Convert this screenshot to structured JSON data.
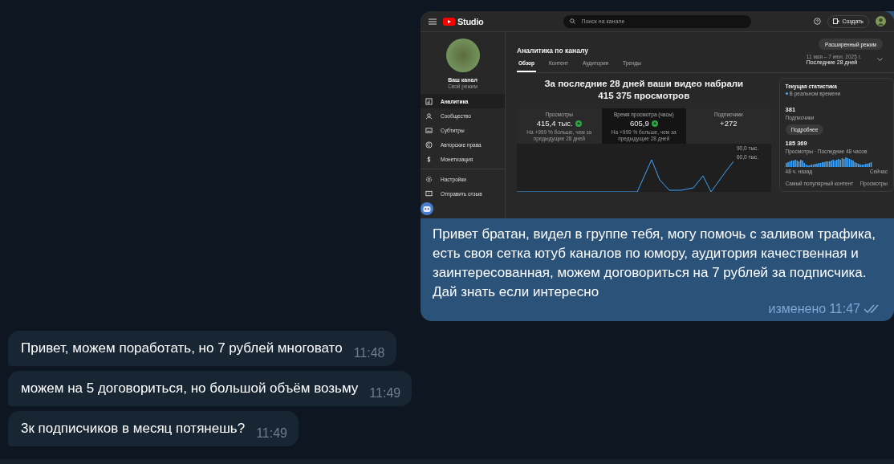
{
  "studio_screenshot": {
    "topbar": {
      "logo_text": "Studio",
      "search": {
        "placeholder": "Поиск на канале"
      },
      "create_button": "Создать"
    },
    "sidebar": {
      "channel_name": "Ваш канал",
      "channel_subtitle": "Свой режим",
      "items": [
        {
          "label": "Аналитика",
          "selected": true
        },
        {
          "label": "Сообщество",
          "selected": false
        },
        {
          "label": "Субтитры",
          "selected": false
        },
        {
          "label": "Авторские права",
          "selected": false
        },
        {
          "label": "Монетизация",
          "selected": false
        }
      ],
      "bottom_items": [
        {
          "label": "Настройки",
          "selected": false
        },
        {
          "label": "Отправить отзыв",
          "selected": false
        }
      ]
    },
    "page_title": "Аналитика по каналу",
    "advanced_button": "Расширенный режим",
    "date_range": {
      "dates": "11 мая – 7 июн. 2025 г.",
      "period": "Последние 28 дней"
    },
    "tabs": [
      {
        "label": "Обзор",
        "selected": true
      },
      {
        "label": "Контент",
        "selected": false
      },
      {
        "label": "Аудитория",
        "selected": false
      },
      {
        "label": "Тренды",
        "selected": false
      }
    ],
    "headline": "За последние 28 дней ваши видео набрали 415 375 просмотров",
    "metrics": [
      {
        "label": "Просмотры",
        "value": "415,4 тыс.",
        "rising": true,
        "note": "На +999 % больше, чем за предыдущие 28 дней",
        "selected": false
      },
      {
        "label": "Время просмотра (часы)",
        "value": "605,9",
        "rising": true,
        "note": "На +999 % больше, чем за предыдущие 28 дней",
        "selected": true
      },
      {
        "label": "Подписчики",
        "value": "+272",
        "rising": false,
        "selected": false
      }
    ],
    "chart_ticks": [
      "90,0 тыс.",
      "60,0 тыс."
    ],
    "realtime": {
      "title": "Текущая статистика",
      "live_label": "В реальном времени",
      "subscribers": "381",
      "subscribers_label": "Подписчики",
      "details_button": "Подробнее",
      "views": "185 369",
      "views_label": "Просмотры · Последние 48 часов",
      "from_label": "48 ч. назад",
      "to_label": "Сейчас",
      "top_content_label": "Самый популярный контент",
      "top_content_column": "Просмотры"
    }
  },
  "outgoing": {
    "text": "Привет братан, видел в группе тебя, могу помочь с заливом трафика, есть своя сетка ютуб каналов по юмору, аудитория качественная и заинтересованная, можем договориться на 7 рублей за подписчика. Дай знать если интересно",
    "edited": "изменено",
    "time": "11:47",
    "read": true
  },
  "incoming": [
    {
      "text": "Привет, можем поработать, но 7 рублей многовато",
      "time": "11:48"
    },
    {
      "text": "можем на 5 договориться, но большой объём возьму",
      "time": "11:49"
    },
    {
      "text": "3к подписчиков в месяц потянешь?",
      "time": "11:49"
    }
  ]
}
